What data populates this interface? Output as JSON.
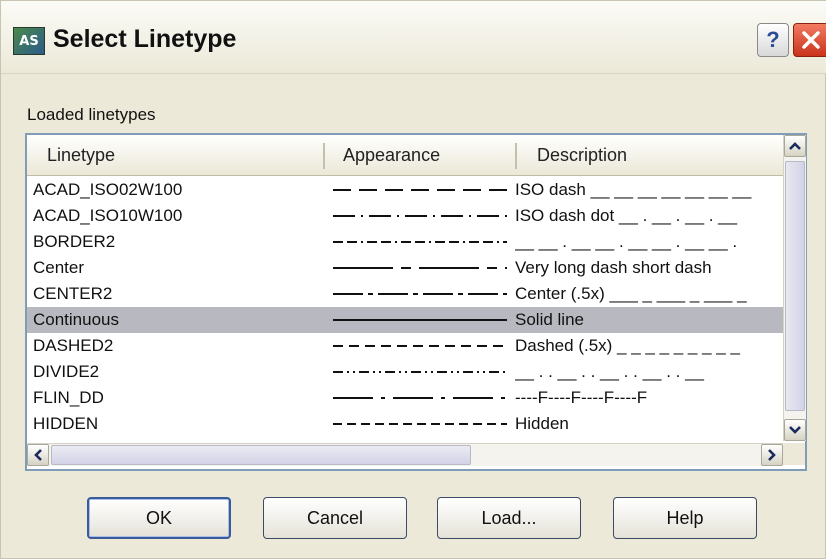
{
  "window": {
    "title": "Select Linetype",
    "app_icon_text": "AS",
    "help_label": "?"
  },
  "group": {
    "label": "Loaded linetypes"
  },
  "columns": [
    "Linetype",
    "Appearance",
    "Description"
  ],
  "linetypes": [
    {
      "name": "ACAD_ISO02W100",
      "pattern": "dash",
      "description": "ISO dash __ __ __ __ __ __ __",
      "selected": false
    },
    {
      "name": "ACAD_ISO10W100",
      "pattern": "dashdot",
      "description": "ISO dash dot __ . __ . __ . __",
      "selected": false
    },
    {
      "name": "BORDER2",
      "pattern": "border",
      "description": "__ __ . __ __ . __ __ . __ __ .",
      "selected": false
    },
    {
      "name": "Center",
      "pattern": "center",
      "description": "Very long dash short dash",
      "selected": false
    },
    {
      "name": "CENTER2",
      "pattern": "center2",
      "description": "Center (.5x) ___ _ ___ _ ___ _",
      "selected": false
    },
    {
      "name": "Continuous",
      "pattern": "solid",
      "description": "Solid line",
      "selected": true
    },
    {
      "name": "DASHED2",
      "pattern": "dashed",
      "description": "Dashed (.5x) _ _ _ _ _ _ _ _ _",
      "selected": false
    },
    {
      "name": "DIVIDE2",
      "pattern": "divide",
      "description": "__ . . __ . . __ . . __ . . __",
      "selected": false
    },
    {
      "name": "FLIN_DD",
      "pattern": "flin",
      "description": "----F----F----F----F",
      "selected": false
    },
    {
      "name": "HIDDEN",
      "pattern": "hidden",
      "description": "Hidden",
      "selected": false
    }
  ],
  "buttons": {
    "ok": "OK",
    "cancel": "Cancel",
    "load": "Load...",
    "help": "Help"
  },
  "colors": {
    "close_red": "#c9331c",
    "selection": "#b8b8c0",
    "face": "#ece9d8"
  }
}
